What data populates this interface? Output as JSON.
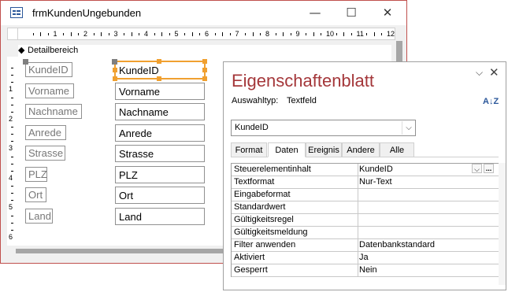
{
  "window": {
    "title": "frmKundenUngebunden",
    "minimize_glyph": "—",
    "maximize_glyph": "☐",
    "close_glyph": "✕"
  },
  "ruler": {
    "numbers": [
      "1",
      "2",
      "3",
      "4",
      "5",
      "6",
      "7",
      "8",
      "9",
      "10",
      "11",
      "12"
    ]
  },
  "vertical_ruler": {
    "numbers": [
      "1",
      "2",
      "3",
      "4",
      "5",
      "6"
    ]
  },
  "section": {
    "label": "Detailbereich",
    "icon": "section-arrow-icon",
    "glyph": "◆"
  },
  "form_controls": [
    {
      "label": "KundeID",
      "textbox": "KundeID",
      "selected": true
    },
    {
      "label": "Vorname",
      "textbox": "Vorname"
    },
    {
      "label": "Nachname",
      "textbox": "Nachname"
    },
    {
      "label": "Anrede",
      "textbox": "Anrede"
    },
    {
      "label": "Strasse",
      "textbox": "Strasse"
    },
    {
      "label": "PLZ",
      "textbox": "PLZ"
    },
    {
      "label": "Ort",
      "textbox": "Ort"
    },
    {
      "label": "Land",
      "textbox": "Land"
    }
  ],
  "property_sheet": {
    "title": "Eigenschaftenblatt",
    "selection_type_label": "Auswahltyp:",
    "selection_type_value": "Textfeld",
    "sort_icon_glyph": "A↓Z",
    "dropdown_glyph": "⌵",
    "close_glyph": "✕",
    "combo_value": "KundeID",
    "combo_glyph": "⌵",
    "tabs": [
      "Format",
      "Daten",
      "Ereignis",
      "Andere",
      "Alle"
    ],
    "active_tab": "Daten",
    "row_button_glyphs": [
      "⌵",
      "..."
    ],
    "properties": [
      {
        "name": "Steuerelementinhalt",
        "value": "KundeID"
      },
      {
        "name": "Textformat",
        "value": "Nur-Text"
      },
      {
        "name": "Eingabeformat",
        "value": ""
      },
      {
        "name": "Standardwert",
        "value": ""
      },
      {
        "name": "Gültigkeitsregel",
        "value": ""
      },
      {
        "name": "Gültigkeitsmeldung",
        "value": ""
      },
      {
        "name": "Filter anwenden",
        "value": "Datenbankstandard"
      },
      {
        "name": "Aktiviert",
        "value": "Ja"
      },
      {
        "name": "Gesperrt",
        "value": "Nein"
      }
    ]
  },
  "colors": {
    "property_sheet_title": "#a4373a",
    "selection_handle": "#f0a030",
    "window_border": "#c0504d"
  }
}
